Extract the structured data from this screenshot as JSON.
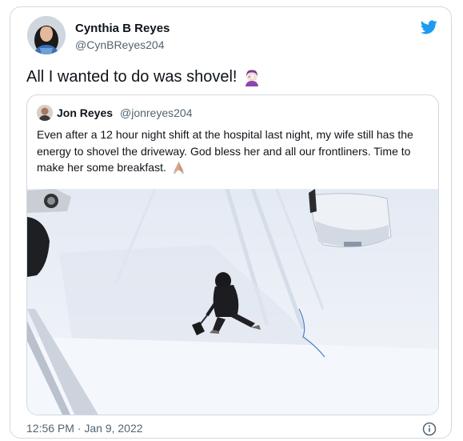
{
  "tweet": {
    "author_name": "Cynthia B Reyes",
    "author_handle": "@CynBReyes204",
    "text": "All I wanted to do was shovel!",
    "text_emoji": "woman-facepalming-emoji",
    "timestamp": "12:56 PM · Jan 9, 2022"
  },
  "quoted_tweet": {
    "author_name": "Jon Reyes",
    "author_handle": "@jonreyes204",
    "text": "Even after a 12 hour night shift at the hospital last night, my wife still has the energy to shovel the driveway. God bless her and all our frontliners. Time to make her some breakfast.",
    "text_emoji": "folded-hands-emoji",
    "media": {
      "description_icon": "snowy-driveway-photo"
    }
  },
  "icons": {
    "brand": "twitter-bird-icon",
    "info": "info-icon"
  },
  "colors": {
    "twitter_blue": "#1d9bf0",
    "text_primary": "#0f1419",
    "text_secondary": "#536471",
    "border": "#cfd9de"
  }
}
